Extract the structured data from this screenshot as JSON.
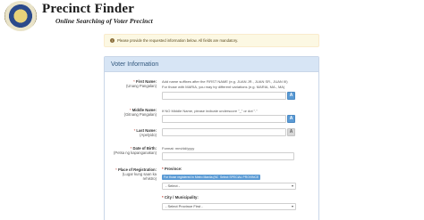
{
  "header": {
    "title": "Precinct Finder",
    "subtitle": "Online Searching of Voter Precinct"
  },
  "alert": {
    "text": "Please provide the requested information below. All fields are mandatory."
  },
  "panel": {
    "title": "Voter Information"
  },
  "first_name": {
    "label": "First Name:",
    "sub_label": "(Unang Pangalan)",
    "hint_1": "Add name suffixes after the FIRST NAME (e.g. JUAN JR., JUAN SR., JUAN III)",
    "hint_2": "For those with MARIA, you may try different variations (e.g. MARIA, MA., MA)",
    "button": "A"
  },
  "middle_name": {
    "label": "Middle Name:",
    "sub_label": "(Gitnang Pangalan)",
    "hint": "If NO Middle Name, please indicate underscore \"_\" or dot \".\"",
    "button": "A"
  },
  "last_name": {
    "label": "Last Name:",
    "sub_label": "(Apelyido)",
    "button": "A"
  },
  "dob": {
    "label": "Date of Birth:",
    "sub_label": "(Petsa ng kapanganakan)",
    "hint": "Format: mm/dd/yyyy"
  },
  "place": {
    "label": "Place of Registration:",
    "sub_label_1": "(Lugar kung saan ka",
    "sub_label_2": "rehistro)",
    "province_label": "Province:",
    "chip_ncr": "For those registered in Metro Manila (NCR)",
    "chip_special": "Select SPECIAL PROVINCE",
    "province_select": "- Select -",
    "city_label": "City / Municipality:",
    "city_select": "- Select Province First -"
  },
  "colors": {
    "accent": "#5b9bd5",
    "panel_head": "#d7e5f5",
    "alert_bg": "#fcf8e3",
    "required": "#c0392b"
  }
}
